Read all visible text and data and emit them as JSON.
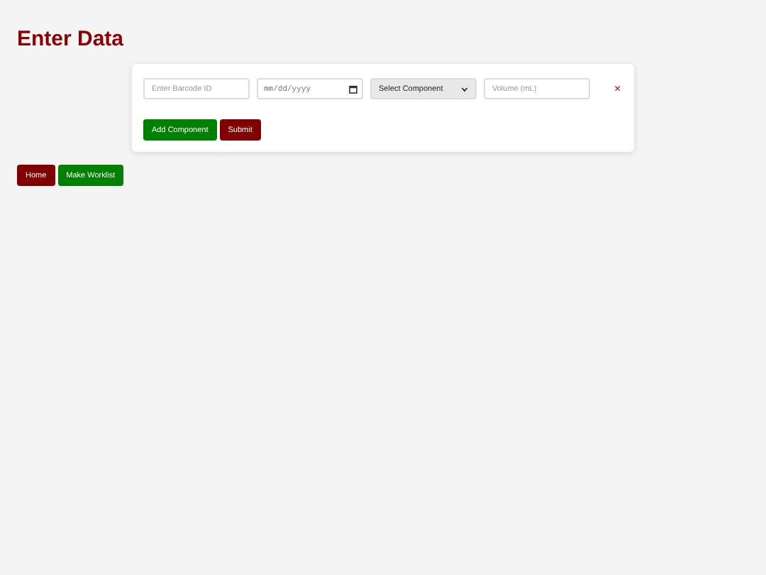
{
  "title": "Enter Data",
  "entry_row": {
    "barcode": {
      "placeholder": "Enter Barcode ID"
    },
    "date": {
      "placeholder": "mm/dd/yyyy"
    },
    "component": {
      "value": "Select Component"
    },
    "volume": {
      "placeholder": "Volume (mL)"
    },
    "remove": "×"
  },
  "card_buttons": [
    {
      "label": "Add Component",
      "kind": "green"
    },
    {
      "label": "Submit",
      "kind": "red"
    }
  ],
  "nav_buttons": [
    {
      "label": "Home",
      "kind": "red"
    },
    {
      "label": "Make Worklist",
      "kind": "green"
    }
  ]
}
